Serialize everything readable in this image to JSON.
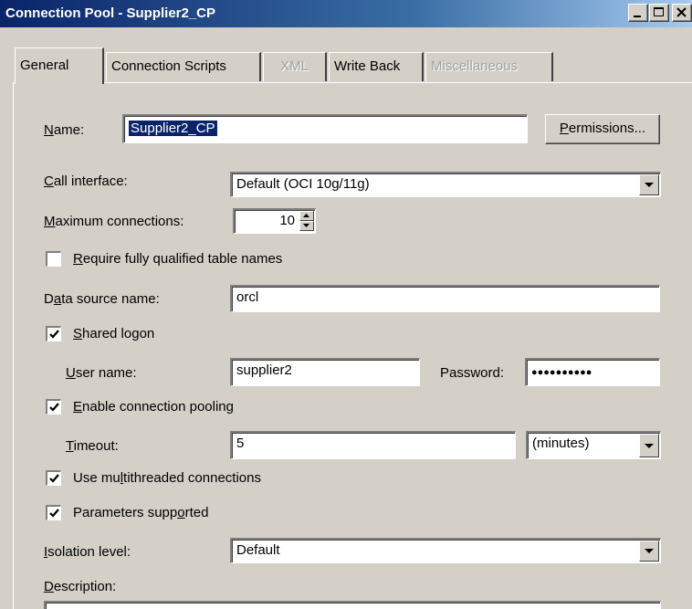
{
  "window": {
    "title": "Connection Pool - Supplier2_CP",
    "controls": [
      "minimize-icon",
      "maximize-icon",
      "close-icon"
    ]
  },
  "tabs": [
    {
      "label": "General",
      "state": "active"
    },
    {
      "label": "Connection Scripts",
      "state": "enabled"
    },
    {
      "label": "XML",
      "state": "disabled"
    },
    {
      "label": "Write Back",
      "state": "enabled"
    },
    {
      "label": "Miscellaneous",
      "state": "disabled"
    }
  ],
  "form": {
    "name": {
      "pre": "",
      "accel": "N",
      "post": "ame:",
      "value": "Supplier2_CP"
    },
    "permissions_button": {
      "pre": "",
      "accel": "P",
      "post": "ermissions..."
    },
    "call_interface": {
      "pre": "",
      "accel": "C",
      "post": "all interface:",
      "value": "Default (OCI 10g/11g)"
    },
    "max_connections": {
      "pre": "",
      "accel": "M",
      "post": "aximum connections:",
      "value": "10"
    },
    "require_qualified": {
      "pre": "",
      "accel": "R",
      "post": "equire fully qualified table names",
      "checked": false
    },
    "data_source": {
      "pre": "D",
      "accel": "a",
      "post": "ta source name:",
      "value": "orcl"
    },
    "shared_logon": {
      "pre": "",
      "accel": "S",
      "post": "hared logon",
      "checked": true
    },
    "user_name": {
      "pre": "",
      "accel": "U",
      "post": "ser name:",
      "value": "supplier2"
    },
    "password": {
      "label": "Password:",
      "value": "●●●●●●●●●●"
    },
    "enable_pooling": {
      "pre": "",
      "accel": "E",
      "post": "nable connection pooling",
      "checked": true
    },
    "timeout": {
      "pre": "",
      "accel": "T",
      "post": "imeout:",
      "value": "5",
      "unit": "(minutes)"
    },
    "multithreaded": {
      "pre": "Use mu",
      "accel": "l",
      "post": "tithreaded connections",
      "checked": true
    },
    "parameters": {
      "pre": "Parameters supp",
      "accel": "o",
      "post": "rted",
      "checked": true
    },
    "isolation": {
      "pre": "",
      "accel": "I",
      "post": "solation level:",
      "value": "Default"
    },
    "description": {
      "pre": "",
      "accel": "D",
      "post": "escription:"
    }
  }
}
